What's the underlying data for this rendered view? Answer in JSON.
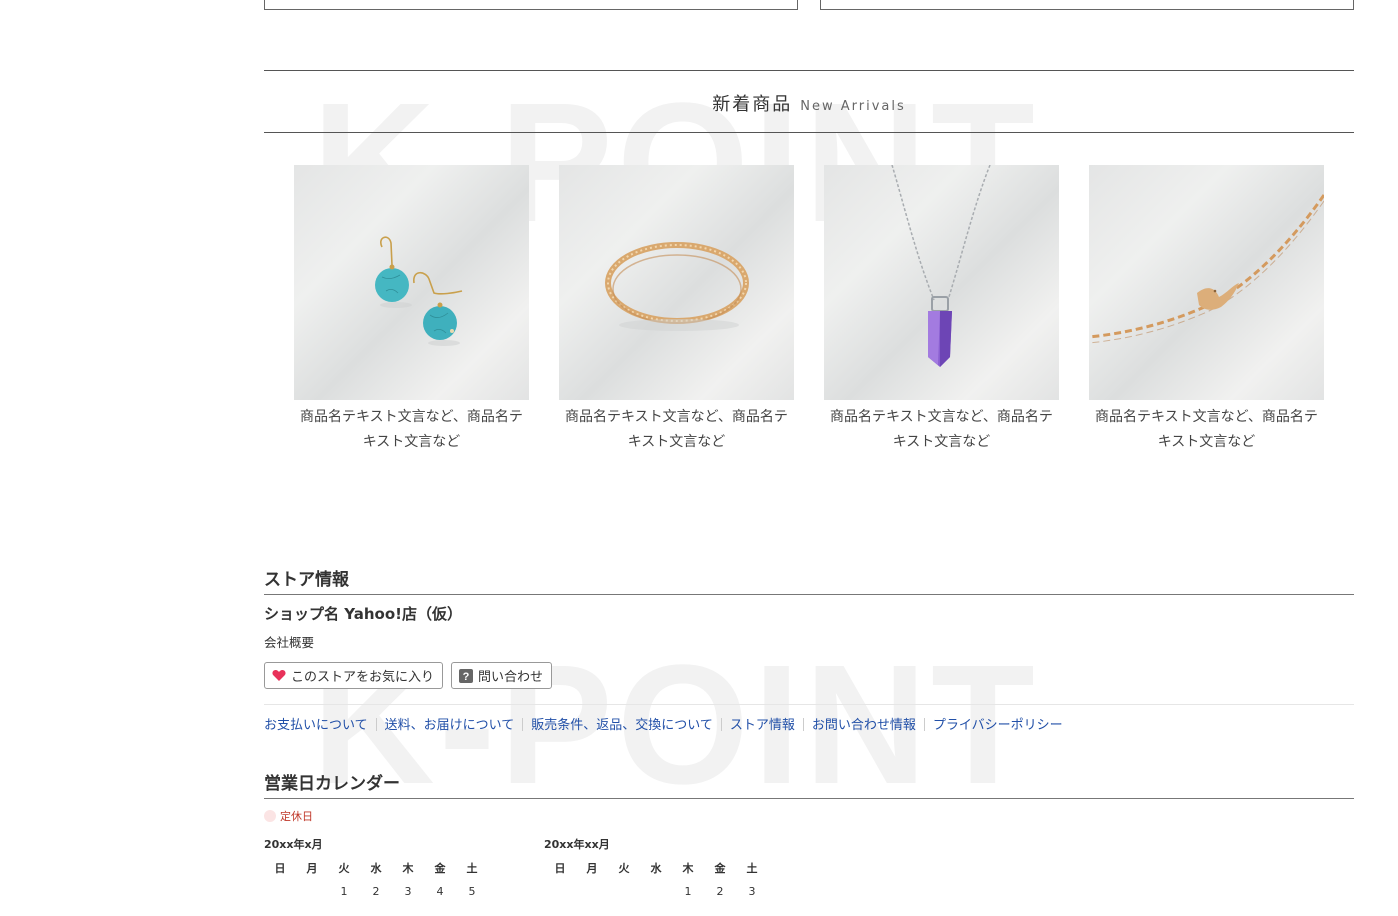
{
  "watermark": "K-POINT",
  "new_arrivals": {
    "title_jp": "新着商品",
    "title_en": "New Arrivals",
    "products": [
      {
        "name": "商品名テキスト文言など、商品名テキスト文言など",
        "image": "turquoise-earrings"
      },
      {
        "name": "商品名テキスト文言など、商品名テキスト文言など",
        "image": "gold-bangle"
      },
      {
        "name": "商品名テキスト文言など、商品名テキスト文言など",
        "image": "amethyst-pendant-necklace"
      },
      {
        "name": "商品名テキスト文言など、商品名テキスト文言など",
        "image": "gold-bird-bracelet"
      }
    ]
  },
  "store_info": {
    "heading": "ストア情報",
    "shop_name": "ショップ名 Yahoo!店（仮）",
    "company_link": "会社概要",
    "favorite_button": "このストアをお気に入り",
    "contact_button": "問い合わせ",
    "links": [
      "お支払いについて",
      "送料、お届けについて",
      "販売条件、返品、交換について",
      "ストア情報",
      "お問い合わせ情報",
      "プライバシーポリシー"
    ]
  },
  "calendar": {
    "heading": "営業日カレンダー",
    "legend": "定休日",
    "weekdays": [
      "日",
      "月",
      "火",
      "水",
      "木",
      "金",
      "土"
    ],
    "months": [
      {
        "label": "20xx年x月",
        "first_row": [
          "",
          "",
          "1",
          "2",
          "3",
          "4",
          "5"
        ]
      },
      {
        "label": "20xx年xx月",
        "first_row": [
          "",
          "",
          "",
          "",
          "1",
          "2",
          "3"
        ]
      }
    ]
  },
  "colors": {
    "link": "#2250a8",
    "holiday": "#c0392b",
    "heart": "#e8325a"
  }
}
